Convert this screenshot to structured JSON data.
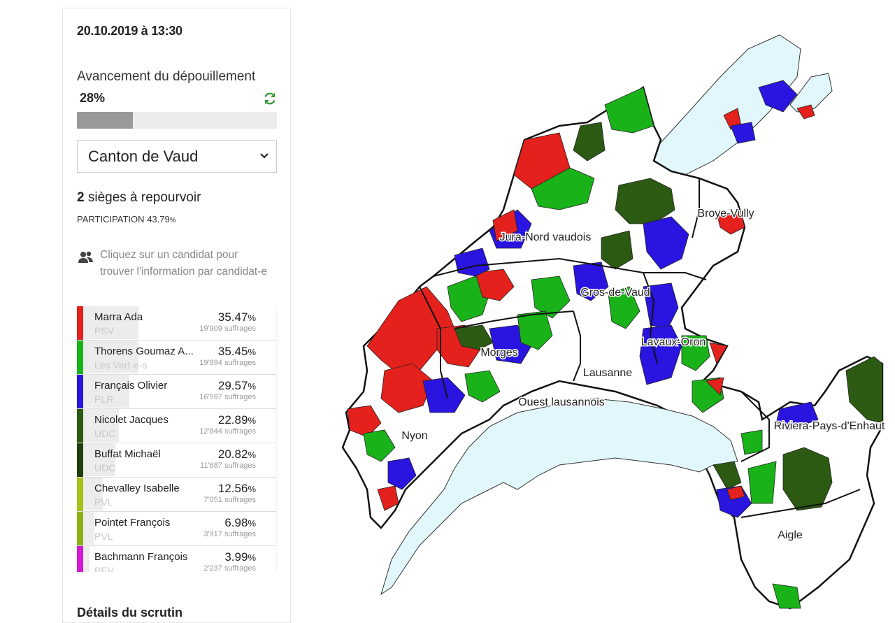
{
  "header": {
    "datetime": "20.10.2019 à 13:30"
  },
  "progress": {
    "label": "Avancement du dépouillement",
    "percent_text": "28%",
    "fraction": 0.28
  },
  "region_select": {
    "selected": "Canton de Vaud"
  },
  "seats": {
    "count": "2",
    "label": "sièges à repourvoir"
  },
  "participation": {
    "label": "PARTICIPATION",
    "value": "43.79",
    "unit": "%"
  },
  "hint": {
    "text": "Cliquez sur un candidat pour trouver l'information par candidat-e"
  },
  "candidates": [
    {
      "name": "Marra Ada",
      "party": "PSV",
      "pct": "35.47",
      "votes": "19'909 suffrages",
      "color": "#e4211c",
      "share": 0.3547
    },
    {
      "name": "Thorens Goumaz A...",
      "party": "Les Vert-e-s",
      "pct": "35.45",
      "votes": "19'894 suffrages",
      "color": "#19b219",
      "share": 0.3545
    },
    {
      "name": "Français Olivier",
      "party": "PLR",
      "pct": "29.57",
      "votes": "16'597 suffrages",
      "color": "#2a14e0",
      "share": 0.2957
    },
    {
      "name": "Nicolet Jacques",
      "party": "UDC",
      "pct": "22.89",
      "votes": "12'844 suffrages",
      "color": "#2c5a12",
      "share": 0.2289
    },
    {
      "name": "Buffat Michaël",
      "party": "UDC",
      "pct": "20.82",
      "votes": "11'687 suffrages",
      "color": "#203f0d",
      "share": 0.2082
    },
    {
      "name": "Chevalley Isabelle",
      "party": "PVL",
      "pct": "12.56",
      "votes": "7'051 suffrages",
      "color": "#a6c11a",
      "share": 0.1256
    },
    {
      "name": "Pointet François",
      "party": "PVL",
      "pct": "6.98",
      "votes": "3'917 suffrages",
      "color": "#8fae12",
      "share": 0.0698
    },
    {
      "name": "Bachmann François",
      "party": "PEV",
      "pct": "3.99",
      "votes": "2'237 suffrages",
      "color": "#d21bd2",
      "share": 0.0399
    }
  ],
  "pct_unit": "%",
  "section_heading": "Détails du scrutin",
  "map": {
    "districts": [
      "Jura-Nord vaudois",
      "Broye-Vully",
      "Gros-de-Vaud",
      "Morges",
      "Lavaux-Oron",
      "Lausanne",
      "Ouest lausannois",
      "Nyon",
      "Riviera-Pays-d'Enhaut",
      "Aigle"
    ],
    "colors": {
      "lake": "#e1f7fb",
      "psv": "#e4211c",
      "vert": "#19b219",
      "plr": "#2a14e0",
      "udc": "#2c5a12",
      "none": "#ffffff"
    }
  }
}
